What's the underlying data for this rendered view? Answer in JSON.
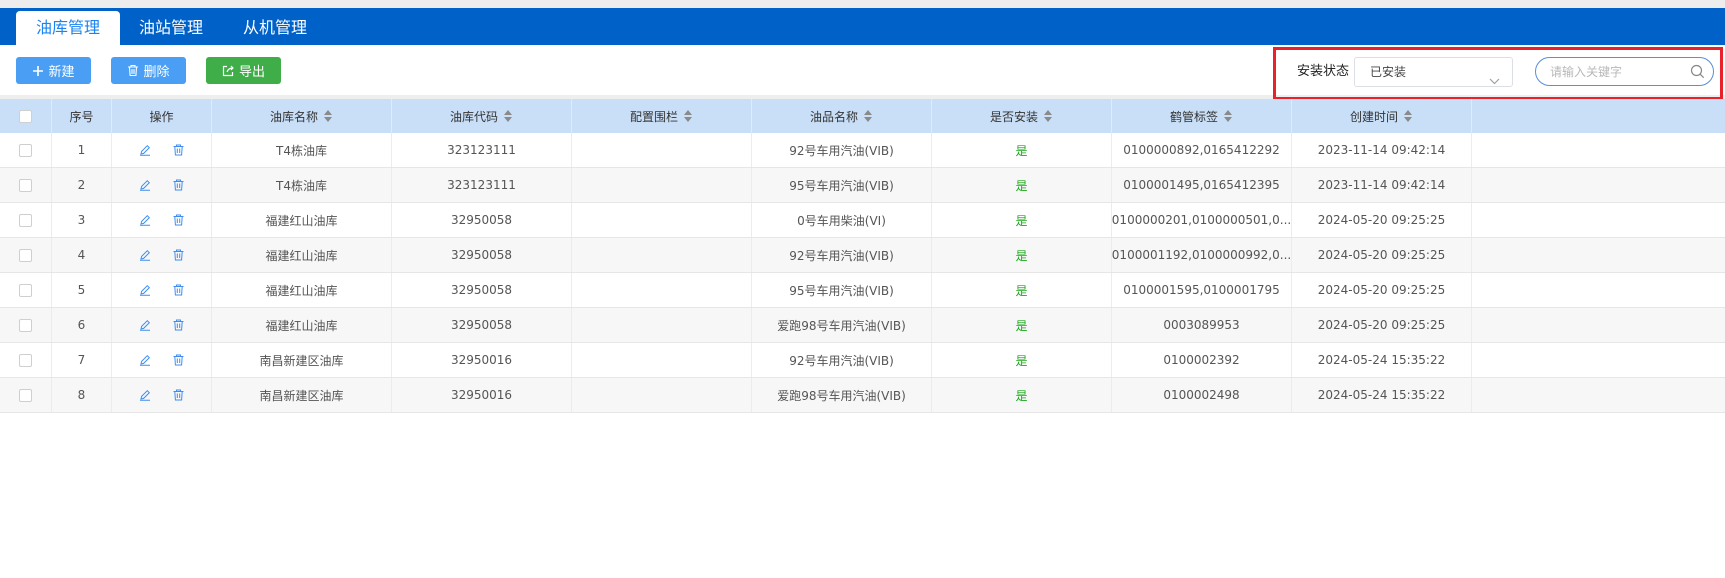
{
  "tabs": [
    {
      "label": "油库管理",
      "active": true
    },
    {
      "label": "油站管理",
      "active": false
    },
    {
      "label": "从机管理",
      "active": false
    }
  ],
  "toolbar": {
    "new_label": "新建",
    "delete_label": "删除",
    "export_label": "导出"
  },
  "filter": {
    "status_label": "安装状态",
    "status_value": "已安装",
    "search_placeholder": "请输入关键字"
  },
  "table": {
    "columns": [
      "序号",
      "操作",
      "油库名称",
      "油库代码",
      "配置围栏",
      "油品名称",
      "是否安装",
      "鹤管标签",
      "创建时间"
    ],
    "rows": [
      {
        "index": "1",
        "depot_name": "T4栋油库",
        "depot_code": "323123111",
        "fence": "",
        "oil_name": "92号车用汽油(VIB)",
        "installed": "是",
        "tags": "0100000892,0165412292",
        "created": "2023-11-14 09:42:14"
      },
      {
        "index": "2",
        "depot_name": "T4栋油库",
        "depot_code": "323123111",
        "fence": "",
        "oil_name": "95号车用汽油(VIB)",
        "installed": "是",
        "tags": "0100001495,0165412395",
        "created": "2023-11-14 09:42:14"
      },
      {
        "index": "3",
        "depot_name": "福建红山油库",
        "depot_code": "32950058",
        "fence": "",
        "oil_name": "0号车用柴油(VI)",
        "installed": "是",
        "tags": "0100000201,0100000501,0...",
        "created": "2024-05-20 09:25:25"
      },
      {
        "index": "4",
        "depot_name": "福建红山油库",
        "depot_code": "32950058",
        "fence": "",
        "oil_name": "92号车用汽油(VIB)",
        "installed": "是",
        "tags": "0100001192,0100000992,0...",
        "created": "2024-05-20 09:25:25"
      },
      {
        "index": "5",
        "depot_name": "福建红山油库",
        "depot_code": "32950058",
        "fence": "",
        "oil_name": "95号车用汽油(VIB)",
        "installed": "是",
        "tags": "0100001595,0100001795",
        "created": "2024-05-20 09:25:25"
      },
      {
        "index": "6",
        "depot_name": "福建红山油库",
        "depot_code": "32950058",
        "fence": "",
        "oil_name": "爱跑98号车用汽油(VIB)",
        "installed": "是",
        "tags": "0003089953",
        "created": "2024-05-20 09:25:25"
      },
      {
        "index": "7",
        "depot_name": "南昌新建区油库",
        "depot_code": "32950016",
        "fence": "",
        "oil_name": "92号车用汽油(VIB)",
        "installed": "是",
        "tags": "0100002392",
        "created": "2024-05-24 15:35:22"
      },
      {
        "index": "8",
        "depot_name": "南昌新建区油库",
        "depot_code": "32950016",
        "fence": "",
        "oil_name": "爱跑98号车用汽油(VIB)",
        "installed": "是",
        "tags": "0100002498",
        "created": "2024-05-24 15:35:22"
      }
    ]
  },
  "colors": {
    "tabbar": "#0062c8",
    "primary_button": "#4a9ff5",
    "export_button": "#3fae49",
    "header_bg": "#c8dff7",
    "installed_text": "#1aa71a",
    "highlight_border": "#e8212b"
  },
  "icons": {
    "new": "plus-icon",
    "delete": "trash-icon",
    "export": "export-icon",
    "row_edit": "pencil-icon",
    "row_delete": "trash-icon",
    "select": "chevron-down-icon",
    "search": "search-icon"
  }
}
